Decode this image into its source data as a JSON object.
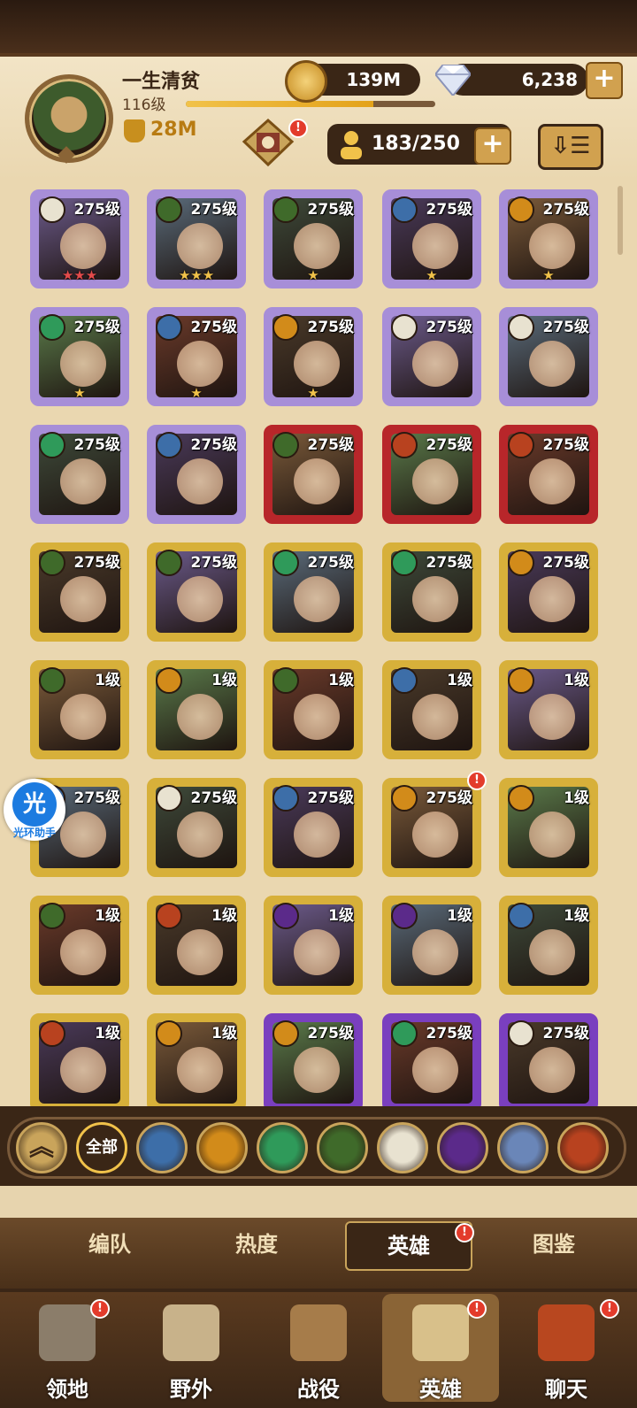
{
  "player": {
    "name": "一生清贫",
    "level": "116级",
    "power": "28M",
    "xp_fraction": 0.75
  },
  "resources": {
    "gold": "139M",
    "gems": "6,238"
  },
  "hero_count": "183/250",
  "colors": {
    "mythic_frame": "#a78ed8",
    "legend_frame": "#d7b03a",
    "red_frame": "#b8262a",
    "purple_frame": "#7a3fbf",
    "badge": "#e33b2b",
    "bar": "#3a2616"
  },
  "heroes": [
    {
      "level": "275级",
      "tier": "mythic",
      "faction": "celestial",
      "stars": "★★★",
      "star_color": "#e34b4b",
      "badge": false
    },
    {
      "level": "275级",
      "tier": "mythic",
      "faction": "graveborn",
      "stars": "★★★",
      "star_color": "#f1c24a",
      "badge": false
    },
    {
      "level": "275级",
      "tier": "mythic",
      "faction": "graveborn",
      "stars": "★",
      "star_color": "#f1c24a",
      "badge": false
    },
    {
      "level": "275级",
      "tier": "mythic",
      "faction": "lightbearer",
      "stars": "★",
      "star_color": "#f1c24a",
      "badge": false
    },
    {
      "level": "275级",
      "tier": "mythic",
      "faction": "mauler",
      "stars": "★",
      "star_color": "#f1c24a",
      "badge": false
    },
    {
      "level": "275级",
      "tier": "mythic",
      "faction": "wilder",
      "stars": "★",
      "star_color": "#f1c24a",
      "badge": false
    },
    {
      "level": "275级",
      "tier": "mythic",
      "faction": "lightbearer",
      "stars": "★",
      "star_color": "#f1c24a",
      "badge": false
    },
    {
      "level": "275级",
      "tier": "mythic",
      "faction": "mauler",
      "stars": "★",
      "star_color": "#f1c24a",
      "badge": false
    },
    {
      "level": "275级",
      "tier": "mythic",
      "faction": "celestial",
      "stars": "",
      "star_color": "#f1c24a",
      "badge": false
    },
    {
      "level": "275级",
      "tier": "mythic",
      "faction": "celestial",
      "stars": "",
      "star_color": "#f1c24a",
      "badge": false
    },
    {
      "level": "275级",
      "tier": "mythic",
      "faction": "wilder",
      "stars": "",
      "star_color": "#f1c24a",
      "badge": false
    },
    {
      "level": "275级",
      "tier": "mythic",
      "faction": "lightbearer",
      "stars": "",
      "star_color": "#f1c24a",
      "badge": false
    },
    {
      "level": "275级",
      "tier": "red",
      "faction": "graveborn",
      "stars": "",
      "star_color": "#f1c24a",
      "badge": false
    },
    {
      "level": "275级",
      "tier": "red",
      "faction": "dimensional",
      "stars": "",
      "star_color": "#f1c24a",
      "badge": false
    },
    {
      "level": "275级",
      "tier": "red",
      "faction": "dimensional",
      "stars": "",
      "star_color": "#f1c24a",
      "badge": false
    },
    {
      "level": "275级",
      "tier": "legend",
      "faction": "graveborn",
      "stars": "",
      "star_color": "#f1c24a",
      "badge": false
    },
    {
      "level": "275级",
      "tier": "legend",
      "faction": "graveborn",
      "stars": "",
      "star_color": "#f1c24a",
      "badge": false
    },
    {
      "level": "275级",
      "tier": "legend",
      "faction": "wilder",
      "stars": "",
      "star_color": "#f1c24a",
      "badge": false
    },
    {
      "level": "275级",
      "tier": "legend",
      "faction": "wilder",
      "stars": "",
      "star_color": "#f1c24a",
      "badge": false
    },
    {
      "level": "275级",
      "tier": "legend",
      "faction": "mauler",
      "stars": "",
      "star_color": "#f1c24a",
      "badge": false
    },
    {
      "level": "1级",
      "tier": "legend",
      "faction": "graveborn",
      "stars": "",
      "star_color": "#f1c24a",
      "badge": false
    },
    {
      "level": "1级",
      "tier": "legend",
      "faction": "mauler",
      "stars": "",
      "star_color": "#f1c24a",
      "badge": false
    },
    {
      "level": "1级",
      "tier": "legend",
      "faction": "graveborn",
      "stars": "",
      "star_color": "#f1c24a",
      "badge": false
    },
    {
      "level": "1级",
      "tier": "legend",
      "faction": "lightbearer",
      "stars": "",
      "star_color": "#f1c24a",
      "badge": false
    },
    {
      "level": "1级",
      "tier": "legend",
      "faction": "mauler",
      "stars": "",
      "star_color": "#f1c24a",
      "badge": false
    },
    {
      "level": "275级",
      "tier": "legend",
      "faction": "lightbearer",
      "stars": "",
      "star_color": "#f1c24a",
      "badge": false
    },
    {
      "level": "275级",
      "tier": "legend",
      "faction": "celestial",
      "stars": "",
      "star_color": "#f1c24a",
      "badge": false
    },
    {
      "level": "275级",
      "tier": "legend",
      "faction": "lightbearer",
      "stars": "",
      "star_color": "#f1c24a",
      "badge": false
    },
    {
      "level": "275级",
      "tier": "legend",
      "faction": "mauler",
      "stars": "",
      "star_color": "#f1c24a",
      "badge": true
    },
    {
      "level": "1级",
      "tier": "legend",
      "faction": "mauler",
      "stars": "",
      "star_color": "#f1c24a",
      "badge": false
    },
    {
      "level": "1级",
      "tier": "legend",
      "faction": "graveborn",
      "stars": "",
      "star_color": "#f1c24a",
      "badge": false
    },
    {
      "level": "1级",
      "tier": "legend",
      "faction": "dimensional",
      "stars": "",
      "star_color": "#f1c24a",
      "badge": false
    },
    {
      "level": "1级",
      "tier": "legend",
      "faction": "hypogean",
      "stars": "",
      "star_color": "#f1c24a",
      "badge": false
    },
    {
      "level": "1级",
      "tier": "legend",
      "faction": "hypogean",
      "stars": "",
      "star_color": "#f1c24a",
      "badge": false
    },
    {
      "level": "1级",
      "tier": "legend",
      "faction": "lightbearer",
      "stars": "",
      "star_color": "#f1c24a",
      "badge": false
    },
    {
      "level": "1级",
      "tier": "legend",
      "faction": "dimensional",
      "stars": "",
      "star_color": "#f1c24a",
      "badge": false
    },
    {
      "level": "1级",
      "tier": "legend",
      "faction": "mauler",
      "stars": "",
      "star_color": "#f1c24a",
      "badge": false
    },
    {
      "level": "275级",
      "tier": "purple",
      "faction": "mauler",
      "stars": "",
      "star_color": "#f1c24a",
      "badge": false
    },
    {
      "level": "275级",
      "tier": "purple",
      "faction": "wilder",
      "stars": "",
      "star_color": "#f1c24a",
      "badge": false
    },
    {
      "level": "275级",
      "tier": "purple",
      "faction": "celestial",
      "stars": "",
      "star_color": "#f1c24a",
      "badge": false
    }
  ],
  "faction_colors": {
    "lightbearer": "#3d6ea8",
    "mauler": "#d28b1a",
    "wilder": "#2f9a5a",
    "graveborn": "#3f6a2a",
    "celestial": "#e8e2d0",
    "hypogean": "#5b2a8a",
    "dimensional": "#b8421f"
  },
  "filters": {
    "all_label": "全部",
    "items": [
      {
        "name": "filter-collapse",
        "color": "#c9a45b"
      },
      {
        "name": "filter-all",
        "color": "#3a2616"
      },
      {
        "name": "filter-lightbearer",
        "color": "#3d6ea8"
      },
      {
        "name": "filter-mauler",
        "color": "#d28b1a"
      },
      {
        "name": "filter-wilder",
        "color": "#2f9a5a"
      },
      {
        "name": "filter-graveborn",
        "color": "#3f6a2a"
      },
      {
        "name": "filter-celestial",
        "color": "#e8e2d0"
      },
      {
        "name": "filter-hypogean",
        "color": "#5b2a8a"
      },
      {
        "name": "filter-dimensional-blue",
        "color": "#6a86b8"
      },
      {
        "name": "filter-dimensional",
        "color": "#b8421f"
      }
    ]
  },
  "subtabs": [
    "编队",
    "热度",
    "英雄",
    "图鉴"
  ],
  "nav": [
    "领地",
    "野外",
    "战役",
    "英雄",
    "聊天"
  ],
  "assist": {
    "glyph": "光",
    "label": "光环助手"
  }
}
